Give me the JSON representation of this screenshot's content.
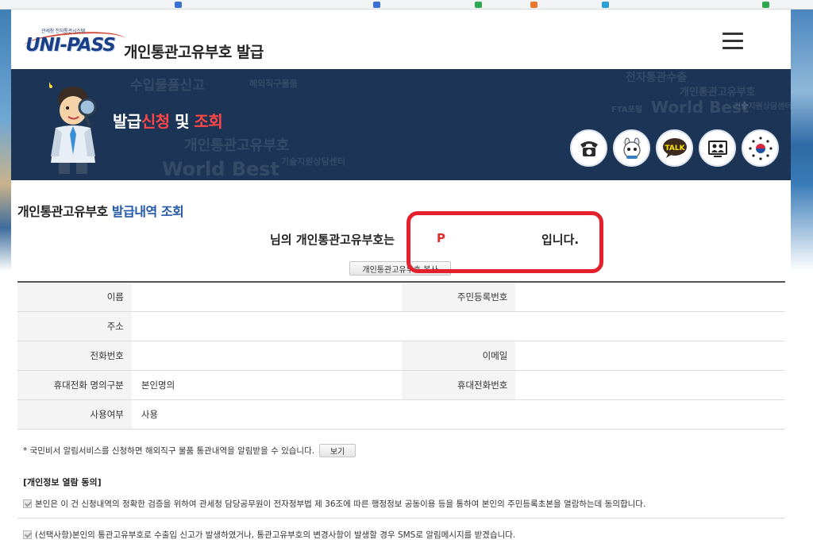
{
  "header": {
    "logo_small": "관세청 전자통관시스템",
    "logo_main": "UNI-PASS",
    "title": "개인통관고유부호 발급",
    "menu_icon": "hamburger-menu-icon"
  },
  "banner": {
    "title_part1": "발급",
    "title_part2": "신청",
    "title_part3": " 및 ",
    "title_part4": "조회",
    "watermarks": [
      "수입물품신고",
      "해외직구물품",
      "개인통관고유부호",
      "전자통관수출",
      "World Best",
      "FTA포털",
      "기술지원상담센터",
      "개인통관고유부호",
      "World Best",
      "기술지원상담센터"
    ],
    "icons": [
      "phone-icon",
      "chatbot-icon",
      "kakao-talk-icon",
      "video-icon",
      "government-emblem-icon"
    ],
    "talk_label": "TALK"
  },
  "section": {
    "title_plain": "개인통관고유부호 ",
    "title_blue": "발급내역 조회"
  },
  "result": {
    "prefix": "님의 개인통관고유부호는",
    "code": "P",
    "suffix": "입니다.",
    "copy_button": "개인통관고유부호 복사"
  },
  "info_table": {
    "name_label": "이름",
    "name_value": "",
    "rrn_label": "주민등록번호",
    "rrn_value": "",
    "address_label": "주소",
    "address_value": "",
    "phone_label": "전화번호",
    "phone_value": "",
    "email_label": "이메일",
    "email_value": "",
    "mobile_type_label": "휴대전화 명의구분",
    "mobile_type_value": "본인명의",
    "mobile_label": "휴대전화번호",
    "mobile_value": "",
    "usage_label": "사용여부",
    "usage_value": "사용"
  },
  "notice": {
    "text": "* 국민비서 알림서비스를 신청하면 해외직구 물품 통관내역을 알림받을 수 있습니다.",
    "button": "보기"
  },
  "consent": {
    "title": "[개인정보 열람 동의]",
    "item1": "본인은 이 건 신청내역의 정확한 검증을 위하여 관세청 담당공무원이 전자정부법 제 36조에 따른 행정정보 공동이용 등을 통하여 본인의 주민등록초본을 열람하는데 동의합니다.",
    "item2": "(선택사항)본인의 통관고유부호로 수출입 신고가 발생하였거나, 통관고유부호의 변경사항이 발생할 경우 SMS로 알림메시지를 받겠습니다."
  },
  "colors": {
    "banner_bg": "#1c3556",
    "accent_red": "#ff4646",
    "accent_blue": "#2458a8",
    "highlight": "#e3202c"
  }
}
